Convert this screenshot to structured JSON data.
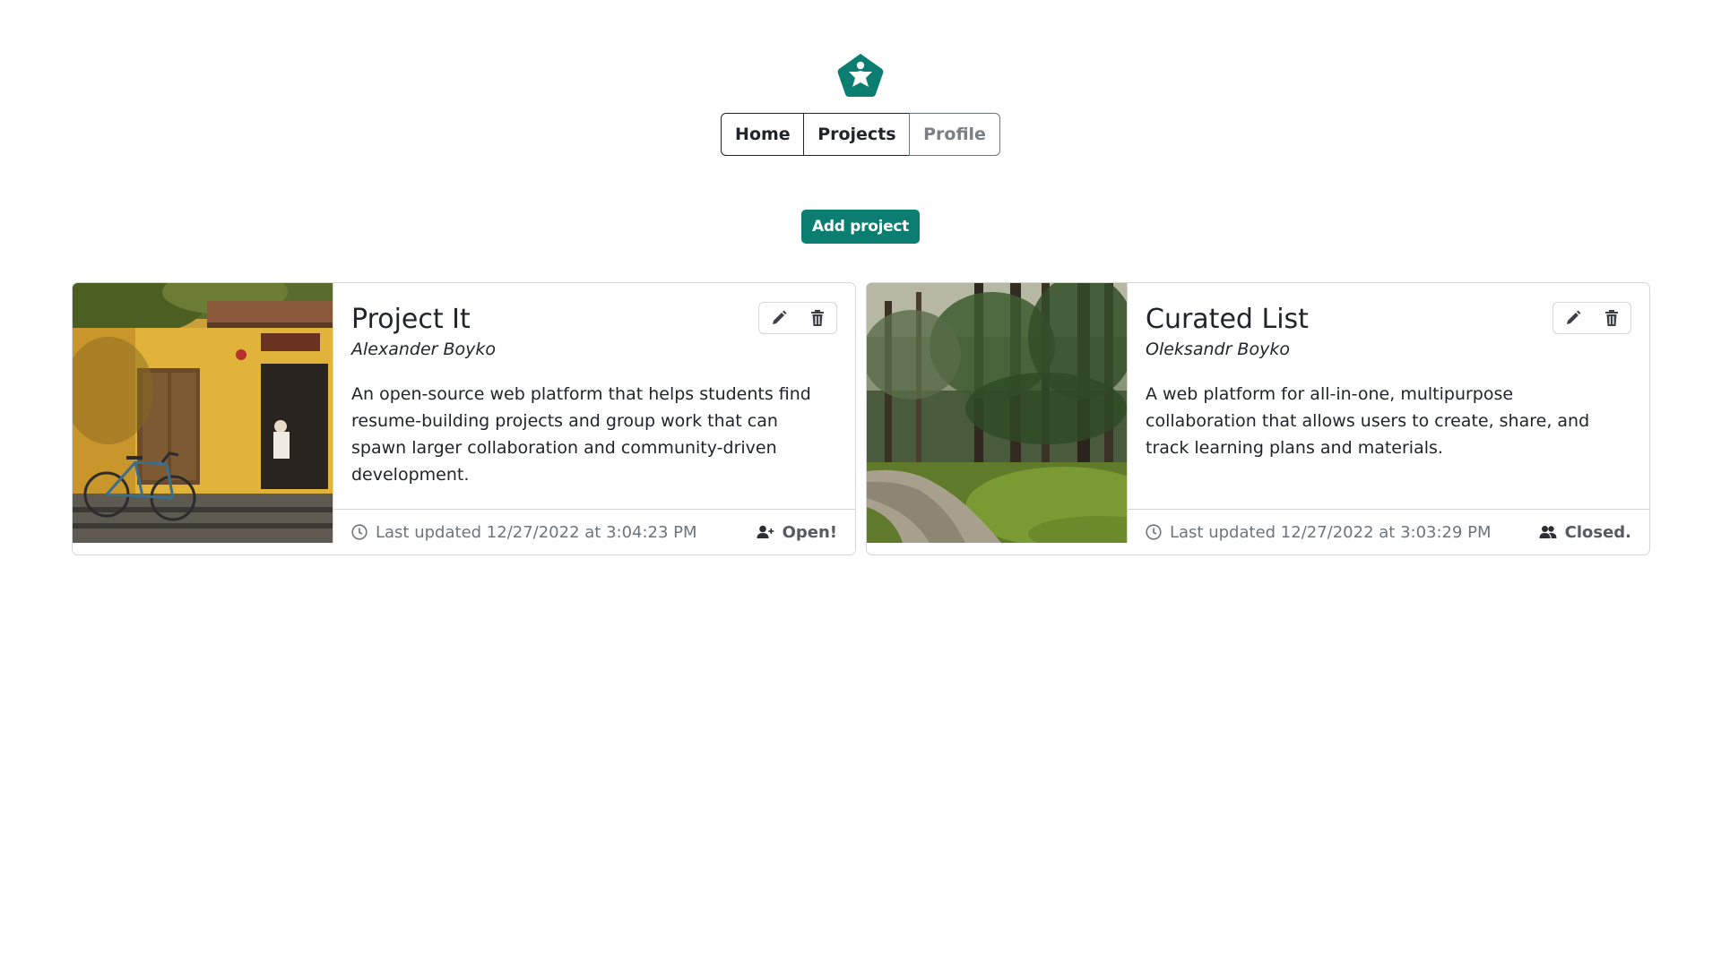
{
  "nav": {
    "home_label": "Home",
    "projects_label": "Projects",
    "profile_label": "Profile"
  },
  "toolbar": {
    "add_project_label": "Add project"
  },
  "colors": {
    "brand": "#0c7e71",
    "text": "#212529",
    "muted": "#6c757d",
    "border": "#d4d6d8"
  },
  "projects": [
    {
      "title": "Project It",
      "author": "Alexander Boyko",
      "description": "An open-source web platform that helps students find resume-building projects and group work that can spawn larger collaboration and community-driven development.",
      "updated": "Last updated 12/27/2022 at 3:04:23 PM",
      "status": "Open!",
      "status_icon": "user-plus-icon",
      "image": "yellow-house-with-bicycle"
    },
    {
      "title": "Curated List",
      "author": "Oleksandr Boyko",
      "description": "A web platform for all-in-one, multipurpose collaboration that allows users to create, share, and track learning plans and materials.",
      "updated": "Last updated 12/27/2022 at 3:03:29 PM",
      "status": "Closed.",
      "status_icon": "users-icon",
      "image": "forest-path"
    }
  ]
}
